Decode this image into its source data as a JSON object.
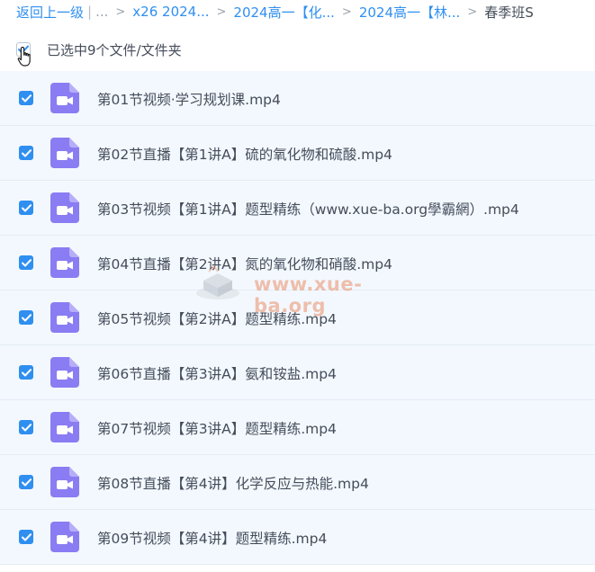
{
  "breadcrumb": {
    "back": "返回上一级",
    "ellipsis": "...",
    "items": [
      "x26 2024...",
      "2024高一【化...",
      "2024高一【林..."
    ],
    "current": "春季班S"
  },
  "selection": {
    "text": "已选中9个文件/文件夹"
  },
  "files": [
    {
      "name": "第01节视频·学习规划课.mp4",
      "checked": true
    },
    {
      "name": "第02节直播【第1讲A】硫的氧化物和硫酸.mp4",
      "checked": true
    },
    {
      "name": "第03节视频【第1讲A】题型精练（www.xue-ba.org學霸網）.mp4",
      "checked": true
    },
    {
      "name": "第04节直播【第2讲A】氮的氧化物和硝酸.mp4",
      "checked": true
    },
    {
      "name": "第05节视频【第2讲A】题型精练.mp4",
      "checked": true
    },
    {
      "name": "第06节直播【第3讲A】氨和铵盐.mp4",
      "checked": true
    },
    {
      "name": "第07节视频【第3讲A】题型精练.mp4",
      "checked": true
    },
    {
      "name": "第08节直播【第4讲】化学反应与热能.mp4",
      "checked": true
    },
    {
      "name": "第09节视频【第4讲】题型精练.mp4",
      "checked": true
    }
  ],
  "watermark": {
    "text": "www.xue-ba.org"
  },
  "colors": {
    "accent": "#2f8ff0",
    "row_bg": "#f3f8fe",
    "video_icon": "#8a7cf3",
    "text": "#454d5a"
  },
  "icons": {
    "file": "video-file-icon",
    "check": "check-icon",
    "cursor": "hand-pointer-cursor"
  }
}
